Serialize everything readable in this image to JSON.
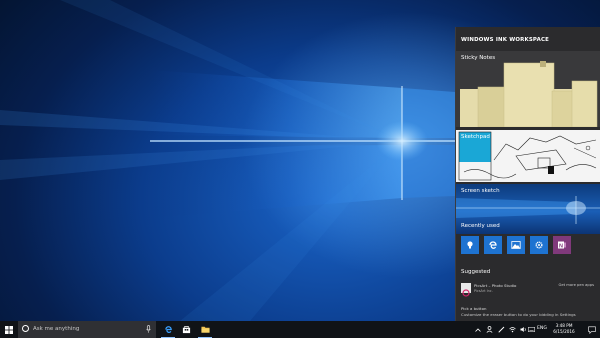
{
  "ink_workspace": {
    "title": "WINDOWS INK WORKSPACE",
    "sticky_notes_label": "Sticky Notes",
    "sketchpad_label": "Sketchpad",
    "screen_sketch_label": "Screen sketch",
    "recently_used_label": "Recently used",
    "recent_apps": [
      "lightbulb-icon",
      "edge-icon",
      "photos-icon",
      "settings-gear-icon",
      "onenote-icon"
    ],
    "suggested_label": "Suggested",
    "suggested_app": {
      "name": "PicsArt – Photo Studio",
      "publisher": "PicsArt Inc.",
      "link": "Get more pen apps"
    },
    "pen_hint": {
      "title": "Pick a button",
      "description": "Customize the eraser button to do your bidding in Settings"
    }
  },
  "taskbar": {
    "search_placeholder": "Ask me anything",
    "language": "ENG",
    "time": "3:48 PM",
    "date": "6/15/2016"
  },
  "colors": {
    "panel_bg": "#2b2b2d",
    "accent_blue": "#1e73d1",
    "onenote_purple": "#80397b",
    "taskbar_bg": "#101317"
  }
}
